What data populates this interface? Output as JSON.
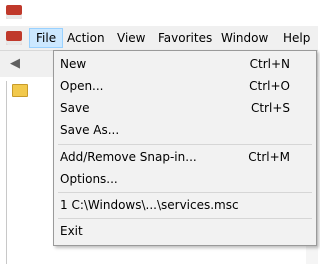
{
  "menubar": {
    "items": [
      {
        "label": "File",
        "active": true
      },
      {
        "label": "Action"
      },
      {
        "label": "View"
      },
      {
        "label": "Favorites"
      },
      {
        "label": "Window"
      },
      {
        "label": "Help"
      }
    ]
  },
  "file_menu": {
    "items": [
      {
        "label": "New",
        "shortcut": "Ctrl+N"
      },
      {
        "label": "Open...",
        "shortcut": "Ctrl+O"
      },
      {
        "label": "Save",
        "shortcut": "Ctrl+S"
      },
      {
        "label": "Save As...",
        "shortcut": ""
      },
      {
        "label": "Add/Remove Snap-in...",
        "shortcut": "Ctrl+M"
      },
      {
        "label": "Options...",
        "shortcut": ""
      },
      {
        "label": "1 C:\\Windows\\...\\services.msc",
        "shortcut": ""
      },
      {
        "label": "Exit",
        "shortcut": ""
      }
    ]
  },
  "colors": {
    "menu_active_bg": "#cce8ff",
    "menu_active_border": "#99d1ff",
    "dropdown_bg": "#f2f2f2",
    "app_icon": "#c0392b"
  },
  "icons": [
    "app-icon",
    "document-icon",
    "back-arrow-icon",
    "folder-icon"
  ]
}
